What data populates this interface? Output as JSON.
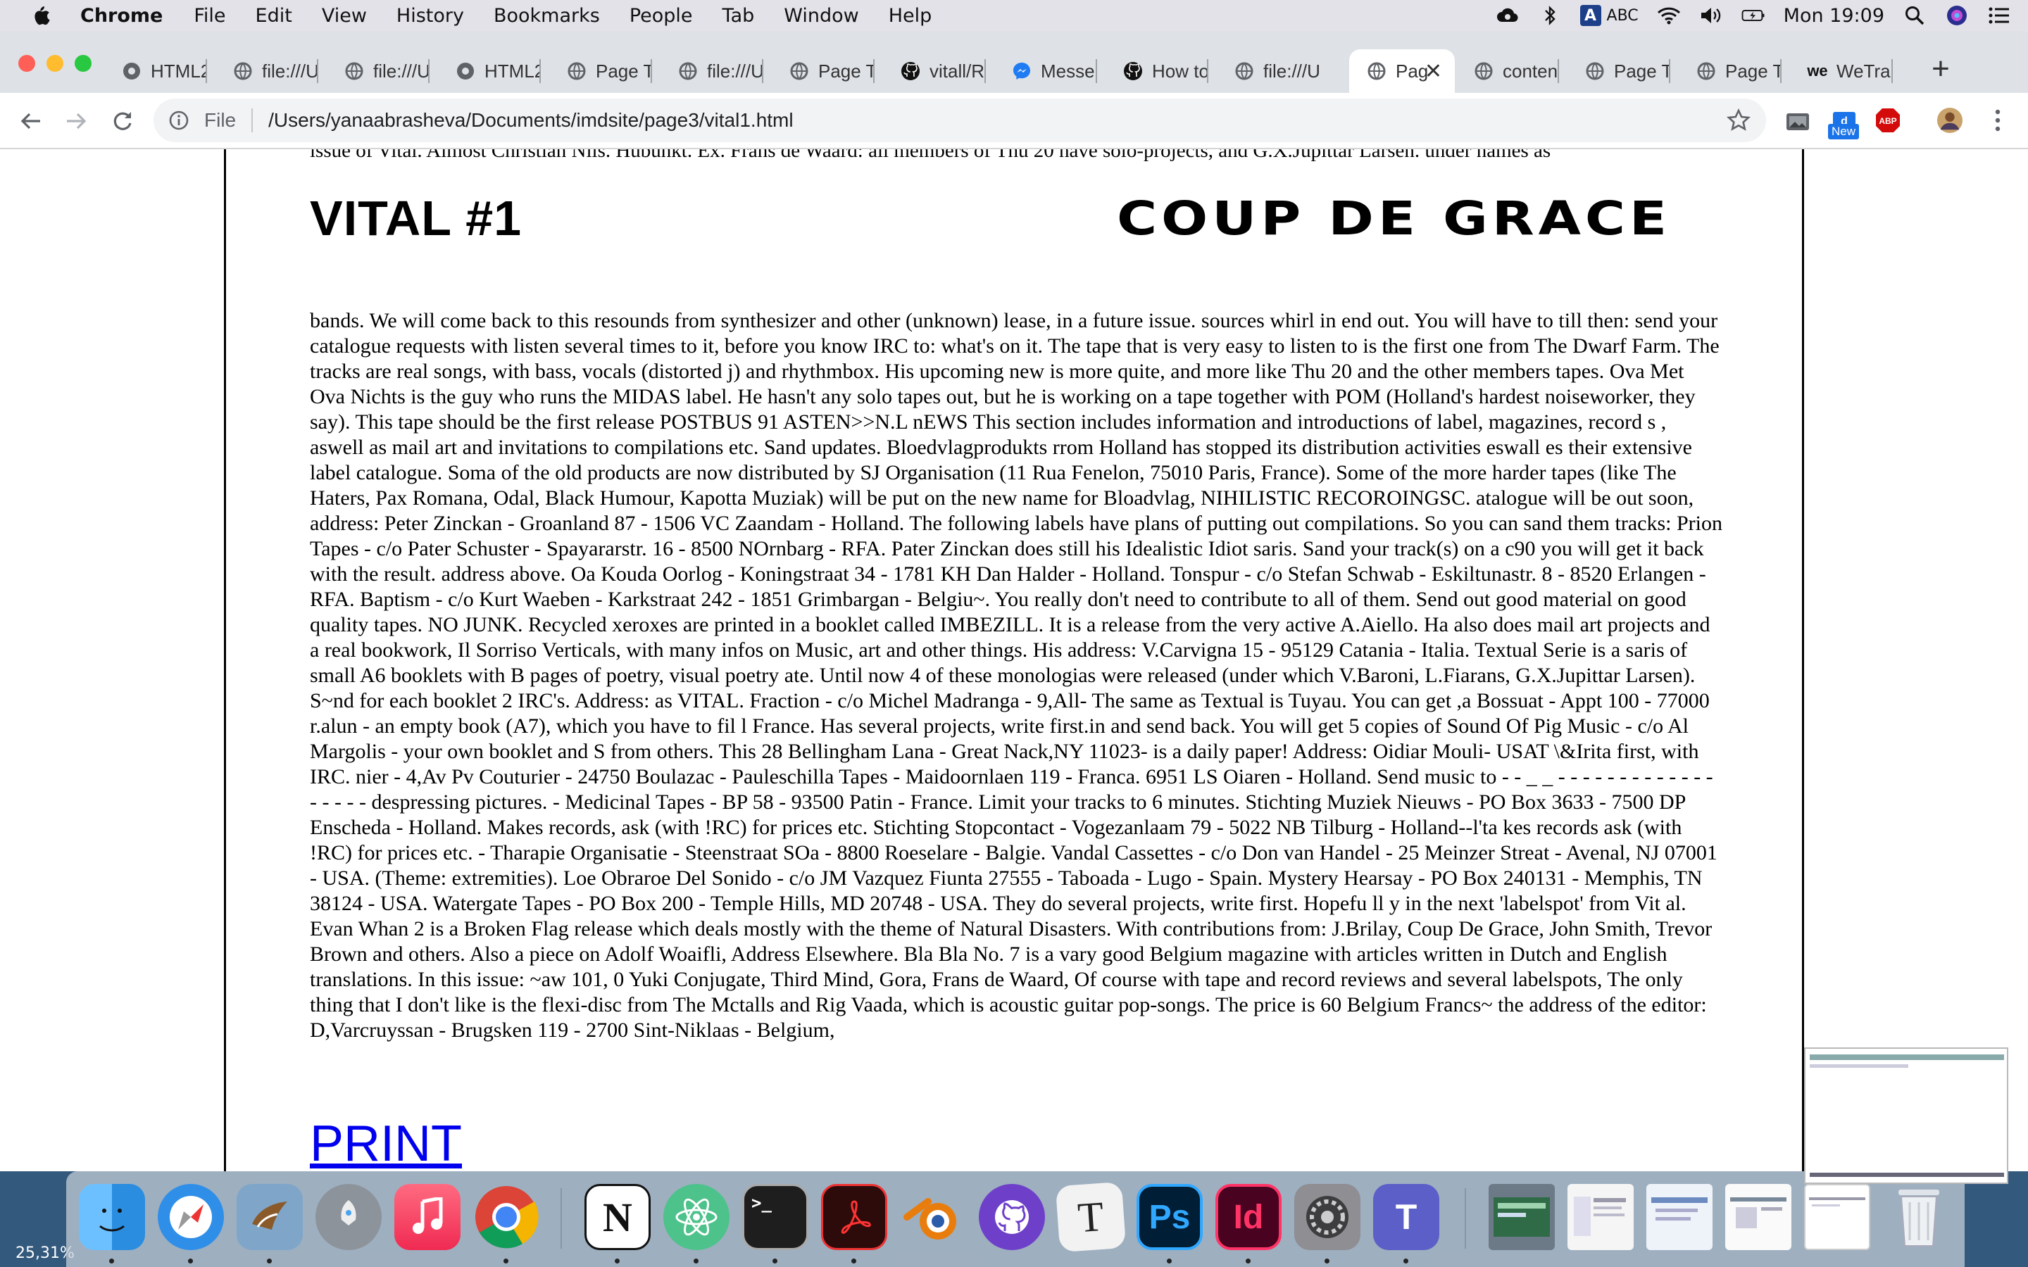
{
  "menubar": {
    "app_name": "Chrome",
    "items": [
      "File",
      "Edit",
      "View",
      "History",
      "Bookmarks",
      "People",
      "Tab",
      "Window",
      "Help"
    ],
    "input_source_label": "A",
    "input_source_abc": "ABC",
    "clock": "Mon 19:09"
  },
  "tabs": [
    {
      "label": "HTML2",
      "icon": "chrome-favicon"
    },
    {
      "label": "file:///U",
      "icon": "globe-icon"
    },
    {
      "label": "file:///U",
      "icon": "globe-icon"
    },
    {
      "label": "HTML2",
      "icon": "chrome-favicon"
    },
    {
      "label": "Page T",
      "icon": "globe-icon"
    },
    {
      "label": "file:///U",
      "icon": "globe-icon"
    },
    {
      "label": "Page T",
      "icon": "globe-icon"
    },
    {
      "label": "vitall/R",
      "icon": "github-icon"
    },
    {
      "label": "Messe",
      "icon": "messenger-icon"
    },
    {
      "label": "How to",
      "icon": "github-icon"
    },
    {
      "label": "file:///U",
      "icon": "globe-icon"
    },
    {
      "label": "Pag",
      "icon": "globe-icon",
      "active": true
    },
    {
      "label": "conten",
      "icon": "globe-icon"
    },
    {
      "label": "Page T",
      "icon": "globe-icon"
    },
    {
      "label": "Page T",
      "icon": "globe-icon"
    },
    {
      "label": "WeTran",
      "icon": "wetransfer-icon"
    }
  ],
  "address_bar": {
    "scheme": "File",
    "url": "/Users/yanaabrasheva/Documents/imdsite/page3/vital1.html"
  },
  "extensions": {
    "new_badge": "New",
    "abp_label": "ABP"
  },
  "page": {
    "cut_line": "issue of Vital. Almost Christian Nils. Hubunkt. Ex. Frans de Waard: all members of Thu 20 have solo-projects, and G.X.Jupittar Larsen. under names as",
    "title": "VITAL #1",
    "band": "COUP DE GRACE",
    "article": "bands. We will come back to this resounds from synthesizer and other (unknown) lease, in a future issue. sources whirl in end out. You will have to till then: send your catalogue requests with listen several times to it, before you know IRC to: what's on it. The tape that is very easy to listen to is the first one from The Dwarf Farm. The tracks are real songs, with bass, vocals (distorted j) and rhythmbox. His upcoming new is more quite, and more like Thu 20 and the other members tapes. Ova Met Ova Nichts is the guy who runs the MIDAS label. He hasn't any solo tapes out, but he is working on a tape together with POM (Holland's hardest noiseworker, they say). This tape should be the first release POSTBUS 91 ASTEN>>N.L nEWS This section includes information and introductions of label, magazines, record s , aswell as mail art and invitations to compilations etc. Sand updates. Bloedvlagprodukts rrom Holland has stopped its distribution activities eswall es their extensive label catalogue. Soma of the old products are now distributed by SJ Organisation (11 Rua Fenelon, 75010 Paris, France). Some of the more harder tapes (like The Haters, Pax Romana, Odal, Black Humour, Kapotta Muziak) will be put on the new name for Bloadvlag, NIHILISTIC RECOROINGSC. atalogue will be out soon, address: Peter Zinckan - Groanland 87 - 1506 VC Zaandam - Holland. The following labels have plans of putting out compilations. So you can sand them tracks: Prion Tapes - c/o Pater Schuster - Spayararstr. 16 - 8500 NOrnbarg - RFA. Pater Zinckan does still his Idealistic Idiot saris. Sand your track(s) on a c90 you will get it back with the result. address above. Oa Kouda Oorlog - Koningstraat 34 - 1781 KH Dan Halder - Holland. Tonspur - c/o Stefan Schwab - Eskiltunastr. 8 - 8520 Erlangen - RFA. Baptism - c/o Kurt Waeben - Karkstraat 242 - 1851 Grimbargan - Belgiu~. You really don't need to contribute to all of them. Send out good material on good quality tapes. NO JUNK. Recycled xeroxes are printed in a booklet called IMBEZILL. It is a release from the very active A.Aiello. Ha also does mail art projects and a real bookwork, Il Sorriso Verticals, with many infos on Music, art and other things. His address: V.Carvigna 15 - 95129 Catania - Italia. Textual Serie is a saris of small A6 booklets with B pages of poetry, visual poetry ate. Until now 4 of these monologias were released (under which V.Baroni, L.Fiarans, G.X.Jupittar Larsen). S~nd for each booklet 2 IRC's. Address: as VITAL. Fraction - c/o Michel Madranga - 9,All- The same as Textual is Tuyau. You can get ,a Bossuat - Appt 100 - 77000 r.alun - an empty book (A7), which you have to fil l France. Has several projects, write first.in and send back. You will get 5 copies of Sound Of Pig Music - c/o Al Margolis - your own booklet and S from others. This 28 Bellingham Lana - Great Nack,NY 11023- is a daily paper! Address: Oidiar Mouli- USAT \\&Irita first, with IRC. nier - 4,Av Pv Couturier - 24750 Boulazac - Pauleschilla Tapes - Maidoornlaen 119 - Franca. 6951 LS Oiaren - Holland. Send music to - - _ _ - - - - - - - - - - - - - - - - - - despressing pictures. - Medicinal Tapes - BP 58 - 93500 Patin - France. Limit your tracks to 6 minutes. Stichting Muziek Nieuws - PO Box 3633 - 7500 DP Enscheda - Holland. Makes records, ask (with !RC) for prices etc. Stichting Stopcontact - Vogezanlaam 79 - 5022 NB Tilburg - Holland--l'ta kes records ask (with !RC) for prices etc. - Tharapie Organisatie - Steenstraat SOa - 8800 Roeselare - Balgie. Vandal Cassettes - c/o Don van Handel - 25 Meinzer Streat - Avenal, NJ 07001 - USA. (Theme: extremities). Loe Obraroe Del Sonido - c/o JM Vazquez Fiunta 27555 - Taboada - Lugo - Spain. Mystery Hearsay - PO Box 240131 - Memphis, TN 38124 - USA. Watergate Tapes - PO Box 200 - Temple Hills, MD 20748 - USA. They do several projects, write first. Hopefu ll y in the next 'labelspot' from Vit al. Evan Whan 2 is a Broken Flag release which deals mostly with the theme of Natural Disasters. With contributions from: J.Brilay, Coup De Grace, John Smith, Trevor Brown and others. Also a piece on Adolf Woaifli, Address Elsewhere. Bla Bla No. 7 is a vary good Belgium magazine with articles written in Dutch and English translations. In this issue: ~aw 101, 0 Yuki Conjugate, Third Mind, Gora, Frans de Waard, Of course with tape and record reviews and several labelspots, The only thing that I don't like is the flexi-disc from The Mctalls and Rig Vaada, which is acoustic guitar pop-songs. The price is 60 Belgium Francs~ the address of the editor: D,Varcruyssan - Brugsken 119 - 2700 Sint-Niklaas - Belgium,",
    "print_link": "PRINT"
  },
  "dock": {
    "zoom_label": "25,31%",
    "apps": [
      {
        "name": "finder-icon",
        "color": "#4aa3f0"
      },
      {
        "name": "safari-icon",
        "color": "#2f8fe8"
      },
      {
        "name": "mail-icon",
        "color": "#7fa6c9"
      },
      {
        "name": "launchpad-icon",
        "color": "#8c939b"
      },
      {
        "name": "music-icon",
        "color": "#f34a6a"
      },
      {
        "name": "chrome-icon",
        "color": "#e0e0e0"
      },
      {
        "name": "notion-icon",
        "color": "#ffffff",
        "glyph": "N"
      },
      {
        "name": "atom-icon",
        "color": "#4dc28b"
      },
      {
        "name": "terminal-icon",
        "color": "#1e1e1e",
        "glyph": ">_"
      },
      {
        "name": "acrobat-icon",
        "color": "#2d0b0b"
      },
      {
        "name": "blender-icon",
        "color": "#e87d0d"
      },
      {
        "name": "github-desktop-icon",
        "color": "#6e40c9"
      },
      {
        "name": "typora-icon",
        "color": "#f2f2f2",
        "glyph": "T"
      },
      {
        "name": "photoshop-icon",
        "color": "#001e36",
        "glyph": "Ps"
      },
      {
        "name": "indesign-icon",
        "color": "#49021f",
        "glyph": "Id"
      },
      {
        "name": "system-preferences-icon",
        "color": "#8e8e93"
      },
      {
        "name": "teams-icon",
        "color": "#5b5fc7",
        "glyph": "T"
      }
    ],
    "minimized": [
      {
        "name": "minimized-window-1"
      },
      {
        "name": "minimized-window-2"
      },
      {
        "name": "minimized-window-3"
      },
      {
        "name": "minimized-window-4"
      },
      {
        "name": "minimized-window-5"
      }
    ],
    "trash": {
      "name": "trash-icon"
    }
  }
}
